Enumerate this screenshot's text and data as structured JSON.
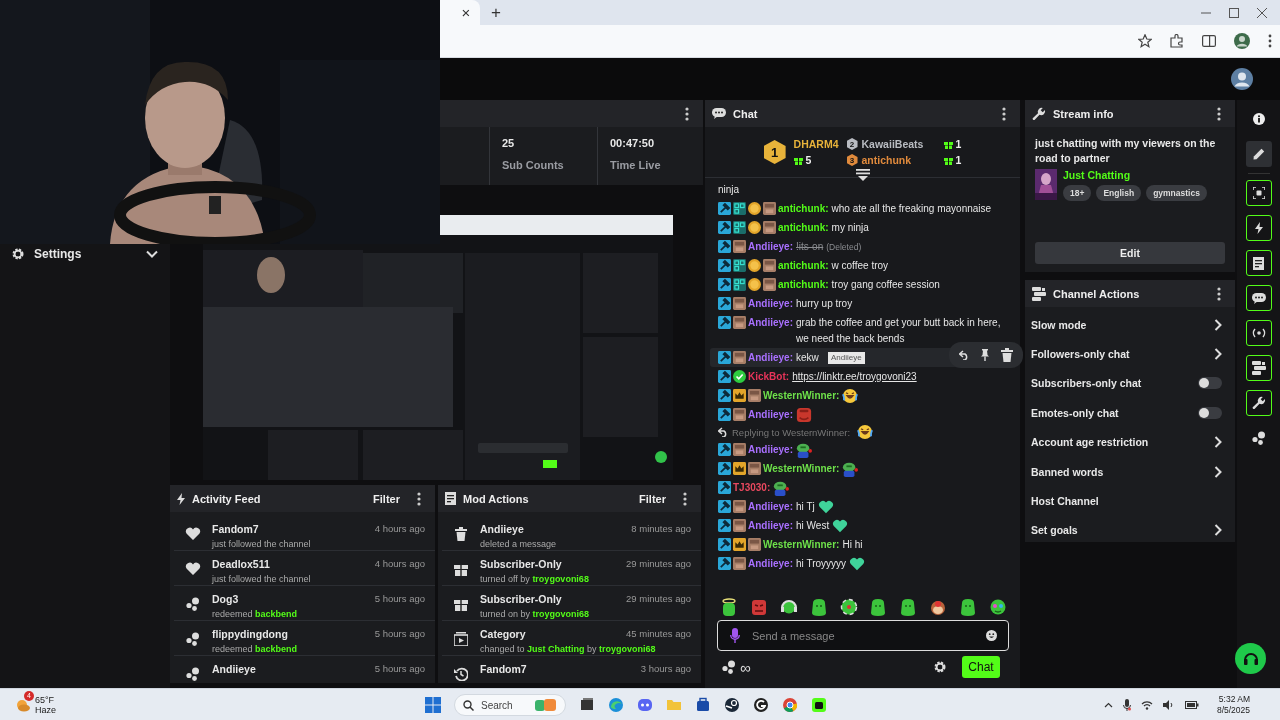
{
  "browser": {
    "tab_close": "×",
    "new_tab": "+"
  },
  "settings_panel": {
    "title": "Settings"
  },
  "stats": [
    {
      "value": "25",
      "label": "Sub Counts"
    },
    {
      "value": "00:47:50",
      "label": "Time Live"
    }
  ],
  "activity_feed": {
    "title": "Activity Feed",
    "filter": "Filter",
    "items": [
      {
        "kind": "heart",
        "name": "Fandom7",
        "time": "4 hours ago",
        "detail": [
          {
            "text": "just followed the channel",
            "highlight": false
          }
        ]
      },
      {
        "kind": "heart",
        "name": "Deadlox511",
        "time": "4 hours ago",
        "detail": [
          {
            "text": "just followed the channel",
            "highlight": false
          }
        ]
      },
      {
        "kind": "points",
        "name": "Dog3",
        "time": "5 hours ago",
        "detail": [
          {
            "text": "redeemed ",
            "highlight": false
          },
          {
            "text": "backbend",
            "highlight": true
          }
        ]
      },
      {
        "kind": "points",
        "name": "flippydingdong",
        "time": "5 hours ago",
        "detail": [
          {
            "text": "redeemed ",
            "highlight": false
          },
          {
            "text": "backbend",
            "highlight": true
          }
        ]
      },
      {
        "kind": "points",
        "name": "Andiieye",
        "time": "5 hours ago"
      }
    ]
  },
  "mod_actions": {
    "title": "Mod Actions",
    "filter": "Filter",
    "items": [
      {
        "kind": "trash",
        "name": "Andiieye",
        "time": "8 minutes ago",
        "detail": [
          {
            "text": "deleted a message",
            "highlight": false
          }
        ]
      },
      {
        "kind": "gift",
        "name": "Subscriber-Only",
        "time": "29 minutes ago",
        "detail": [
          {
            "text": "turned off by ",
            "highlight": false
          },
          {
            "text": "troygovoni68",
            "highlight": true
          }
        ]
      },
      {
        "kind": "gift",
        "name": "Subscriber-Only",
        "time": "29 minutes ago",
        "detail": [
          {
            "text": "turned on by ",
            "highlight": false
          },
          {
            "text": "troygovoni68",
            "highlight": true
          }
        ]
      },
      {
        "kind": "category",
        "name": "Category",
        "time": "45 minutes ago",
        "detail": [
          {
            "text": "changed to ",
            "highlight": false
          },
          {
            "text": "Just Chatting",
            "highlight": true
          },
          {
            "text": " by ",
            "highlight": false
          },
          {
            "text": "troygovoni68",
            "highlight": true
          }
        ]
      },
      {
        "kind": "history",
        "name": "Fandom7",
        "time": "3 hours ago"
      }
    ]
  },
  "chat": {
    "title": "Chat",
    "leaderboard": [
      {
        "rank": "1",
        "name": "DHARM4",
        "gifts": "5",
        "color": "#e8b33a"
      },
      {
        "rank": "2",
        "name": "KawaiiBeats",
        "gifts": "1",
        "color": "#b9bcc2"
      },
      {
        "rank": "3",
        "name": "antichunk",
        "gifts": "1",
        "color": "#e08a3c"
      }
    ],
    "messages": [
      {
        "kind": "continuation",
        "text": "ninja",
        "hovered": false
      },
      {
        "kind": "text",
        "badges": [
          {
            "kind": "mod"
          },
          {
            "kind": "og"
          },
          {
            "kind": "coin"
          },
          {
            "kind": "sub"
          }
        ],
        "user": "antichunk:",
        "color": "#53fc18",
        "text": "who ate all the freaking mayonnaise",
        "hovered": false
      },
      {
        "kind": "text",
        "badges": [
          {
            "kind": "mod"
          },
          {
            "kind": "og"
          },
          {
            "kind": "coin"
          },
          {
            "kind": "sub"
          }
        ],
        "user": "antichunk:",
        "color": "#53fc18",
        "text": "my ninja",
        "hovered": false
      },
      {
        "kind": "deleted",
        "badges": [
          {
            "kind": "mod"
          },
          {
            "kind": "sub"
          }
        ],
        "user": "Andiieye:",
        "color": "#a970ff",
        "text": "!its-on",
        "deleted_label": "(Deleted)",
        "hovered": false
      },
      {
        "kind": "text",
        "badges": [
          {
            "kind": "mod"
          },
          {
            "kind": "og"
          },
          {
            "kind": "coin"
          },
          {
            "kind": "sub"
          }
        ],
        "user": "antichunk:",
        "color": "#53fc18",
        "text": "w coffee troy",
        "hovered": false
      },
      {
        "kind": "text",
        "badges": [
          {
            "kind": "mod"
          },
          {
            "kind": "og"
          },
          {
            "kind": "coin"
          },
          {
            "kind": "sub"
          }
        ],
        "user": "antichunk:",
        "color": "#53fc18",
        "text": "troy gang coffee session",
        "hovered": false
      },
      {
        "kind": "text",
        "badges": [
          {
            "kind": "mod"
          },
          {
            "kind": "sub"
          }
        ],
        "user": "Andiieye:",
        "color": "#a970ff",
        "text": "hurry up troy",
        "hovered": false
      },
      {
        "kind": "text",
        "badges": [
          {
            "kind": "mod"
          },
          {
            "kind": "sub"
          }
        ],
        "user": "Andiieye:",
        "color": "#a970ff",
        "text": "grab the coffee and get your butt back in here, we need the back bends",
        "hovered": false
      },
      {
        "kind": "text",
        "badges": [
          {
            "kind": "mod"
          },
          {
            "kind": "sub"
          }
        ],
        "user": "Andiieye:",
        "color": "#a970ff",
        "text": "kekw",
        "hovered": true
      },
      {
        "kind": "link",
        "badges": [
          {
            "kind": "mod"
          },
          {
            "kind": "verified"
          }
        ],
        "user": "KickBot:",
        "color": "#e8345a",
        "text": "https://linktr.ee/troygovoni23",
        "hovered": false
      },
      {
        "kind": "text",
        "badges": [
          {
            "kind": "mod"
          },
          {
            "kind": "crown"
          },
          {
            "kind": "sub"
          }
        ],
        "user": "WesternWinner:",
        "color": "#6ee14a",
        "emotes": [
          {
            "kind": "laugh"
          }
        ],
        "hovered": false
      },
      {
        "kind": "text",
        "badges": [
          {
            "kind": "mod"
          },
          {
            "kind": "sub"
          }
        ],
        "user": "Andiieye:",
        "color": "#a970ff",
        "emotes": [
          {
            "kind": "redface"
          }
        ],
        "hovered": false
      },
      {
        "kind": "text",
        "badges": [
          {
            "kind": "mod"
          },
          {
            "kind": "sub"
          }
        ],
        "user": "Andiieye:",
        "color": "#a970ff",
        "reply": {
          "text": "Replying to WesternWinner:",
          "emote": {
            "kind": "laugh"
          }
        },
        "emotes": [
          {
            "kind": "frog"
          }
        ],
        "hovered": false
      },
      {
        "kind": "text",
        "badges": [
          {
            "kind": "mod"
          },
          {
            "kind": "crown"
          },
          {
            "kind": "sub"
          }
        ],
        "user": "WesternWinner:",
        "color": "#6ee14a",
        "emotes": [
          {
            "kind": "frog"
          }
        ],
        "hovered": false
      },
      {
        "kind": "text",
        "badges": [
          {
            "kind": "mod"
          }
        ],
        "user": "TJ3030:",
        "color": "#e8485e",
        "emotes": [
          {
            "kind": "frog"
          }
        ],
        "hovered": false
      },
      {
        "kind": "text",
        "badges": [
          {
            "kind": "mod"
          },
          {
            "kind": "sub"
          }
        ],
        "user": "Andiieye:",
        "color": "#a970ff",
        "text": "hi Tj",
        "emotes": [
          {
            "kind": "heart"
          }
        ],
        "hovered": false
      },
      {
        "kind": "text",
        "badges": [
          {
            "kind": "mod"
          },
          {
            "kind": "sub"
          }
        ],
        "user": "Andiieye:",
        "color": "#a970ff",
        "text": "hi West",
        "emotes": [
          {
            "kind": "heart"
          }
        ],
        "hovered": false
      },
      {
        "kind": "text",
        "badges": [
          {
            "kind": "mod"
          },
          {
            "kind": "crown"
          },
          {
            "kind": "sub"
          }
        ],
        "user": "WesternWinner:",
        "color": "#6ee14a",
        "text": "Hi hi",
        "hovered": false
      },
      {
        "kind": "text",
        "badges": [
          {
            "kind": "mod"
          },
          {
            "kind": "sub"
          }
        ],
        "user": "Andiieye:",
        "color": "#a970ff",
        "text": "hi Troyyyyy",
        "emotes": [
          {
            "kind": "heart"
          }
        ],
        "hovered": false
      }
    ],
    "hover_tooltip": "Andiieye",
    "emote_bar": [
      {
        "kind": "halo"
      },
      {
        "kind": "rage"
      },
      {
        "kind": "headset"
      },
      {
        "kind": "blob"
      },
      {
        "kind": "ball"
      },
      {
        "kind": "blob"
      },
      {
        "kind": "blob"
      },
      {
        "kind": "monkey"
      },
      {
        "kind": "blob"
      },
      {
        "kind": "sick"
      }
    ],
    "input": {
      "placeholder": "Send a message"
    },
    "points": "∞",
    "send": "Chat"
  },
  "stream_info": {
    "title": "Stream info",
    "stream_title": "just chatting with my viewers on the road to partner",
    "category": "Just Chatting",
    "tags": [
      "18+",
      "English",
      "gymnastics"
    ],
    "edit": "Edit"
  },
  "channel_actions": {
    "title": "Channel Actions",
    "items": [
      {
        "label": "Slow mode",
        "kind": "submenu"
      },
      {
        "label": "Followers-only chat",
        "kind": "submenu"
      },
      {
        "label": "Subscribers-only chat",
        "kind": "toggle",
        "on": false
      },
      {
        "label": "Emotes-only chat",
        "kind": "toggle",
        "on": false
      },
      {
        "label": "Account age restriction",
        "kind": "submenu"
      },
      {
        "label": "Banned words",
        "kind": "submenu"
      },
      {
        "label": "Host Channel",
        "kind": "plain"
      },
      {
        "label": "Set goals",
        "kind": "submenu"
      }
    ]
  },
  "rail": [
    {
      "kind": "info",
      "selected": false,
      "active": false
    },
    {
      "kind": "pencil",
      "selected": true,
      "active": false
    },
    {
      "kind": "scan",
      "selected": false,
      "active": true
    },
    {
      "kind": "bolt",
      "selected": false,
      "active": true
    },
    {
      "kind": "document",
      "selected": false,
      "active": true
    },
    {
      "kind": "chat",
      "selected": false,
      "active": true
    },
    {
      "kind": "broadcast",
      "selected": false,
      "active": true
    },
    {
      "kind": "actions",
      "selected": false,
      "active": true
    },
    {
      "kind": "wrench",
      "selected": false,
      "active": true
    },
    {
      "kind": "points",
      "selected": false,
      "active": false
    }
  ],
  "taskbar": {
    "weather_badge": "4",
    "temperature": "65°F",
    "condition": "Haze",
    "search": "Search",
    "time": "5:32 AM",
    "date": "8/5/2025"
  }
}
